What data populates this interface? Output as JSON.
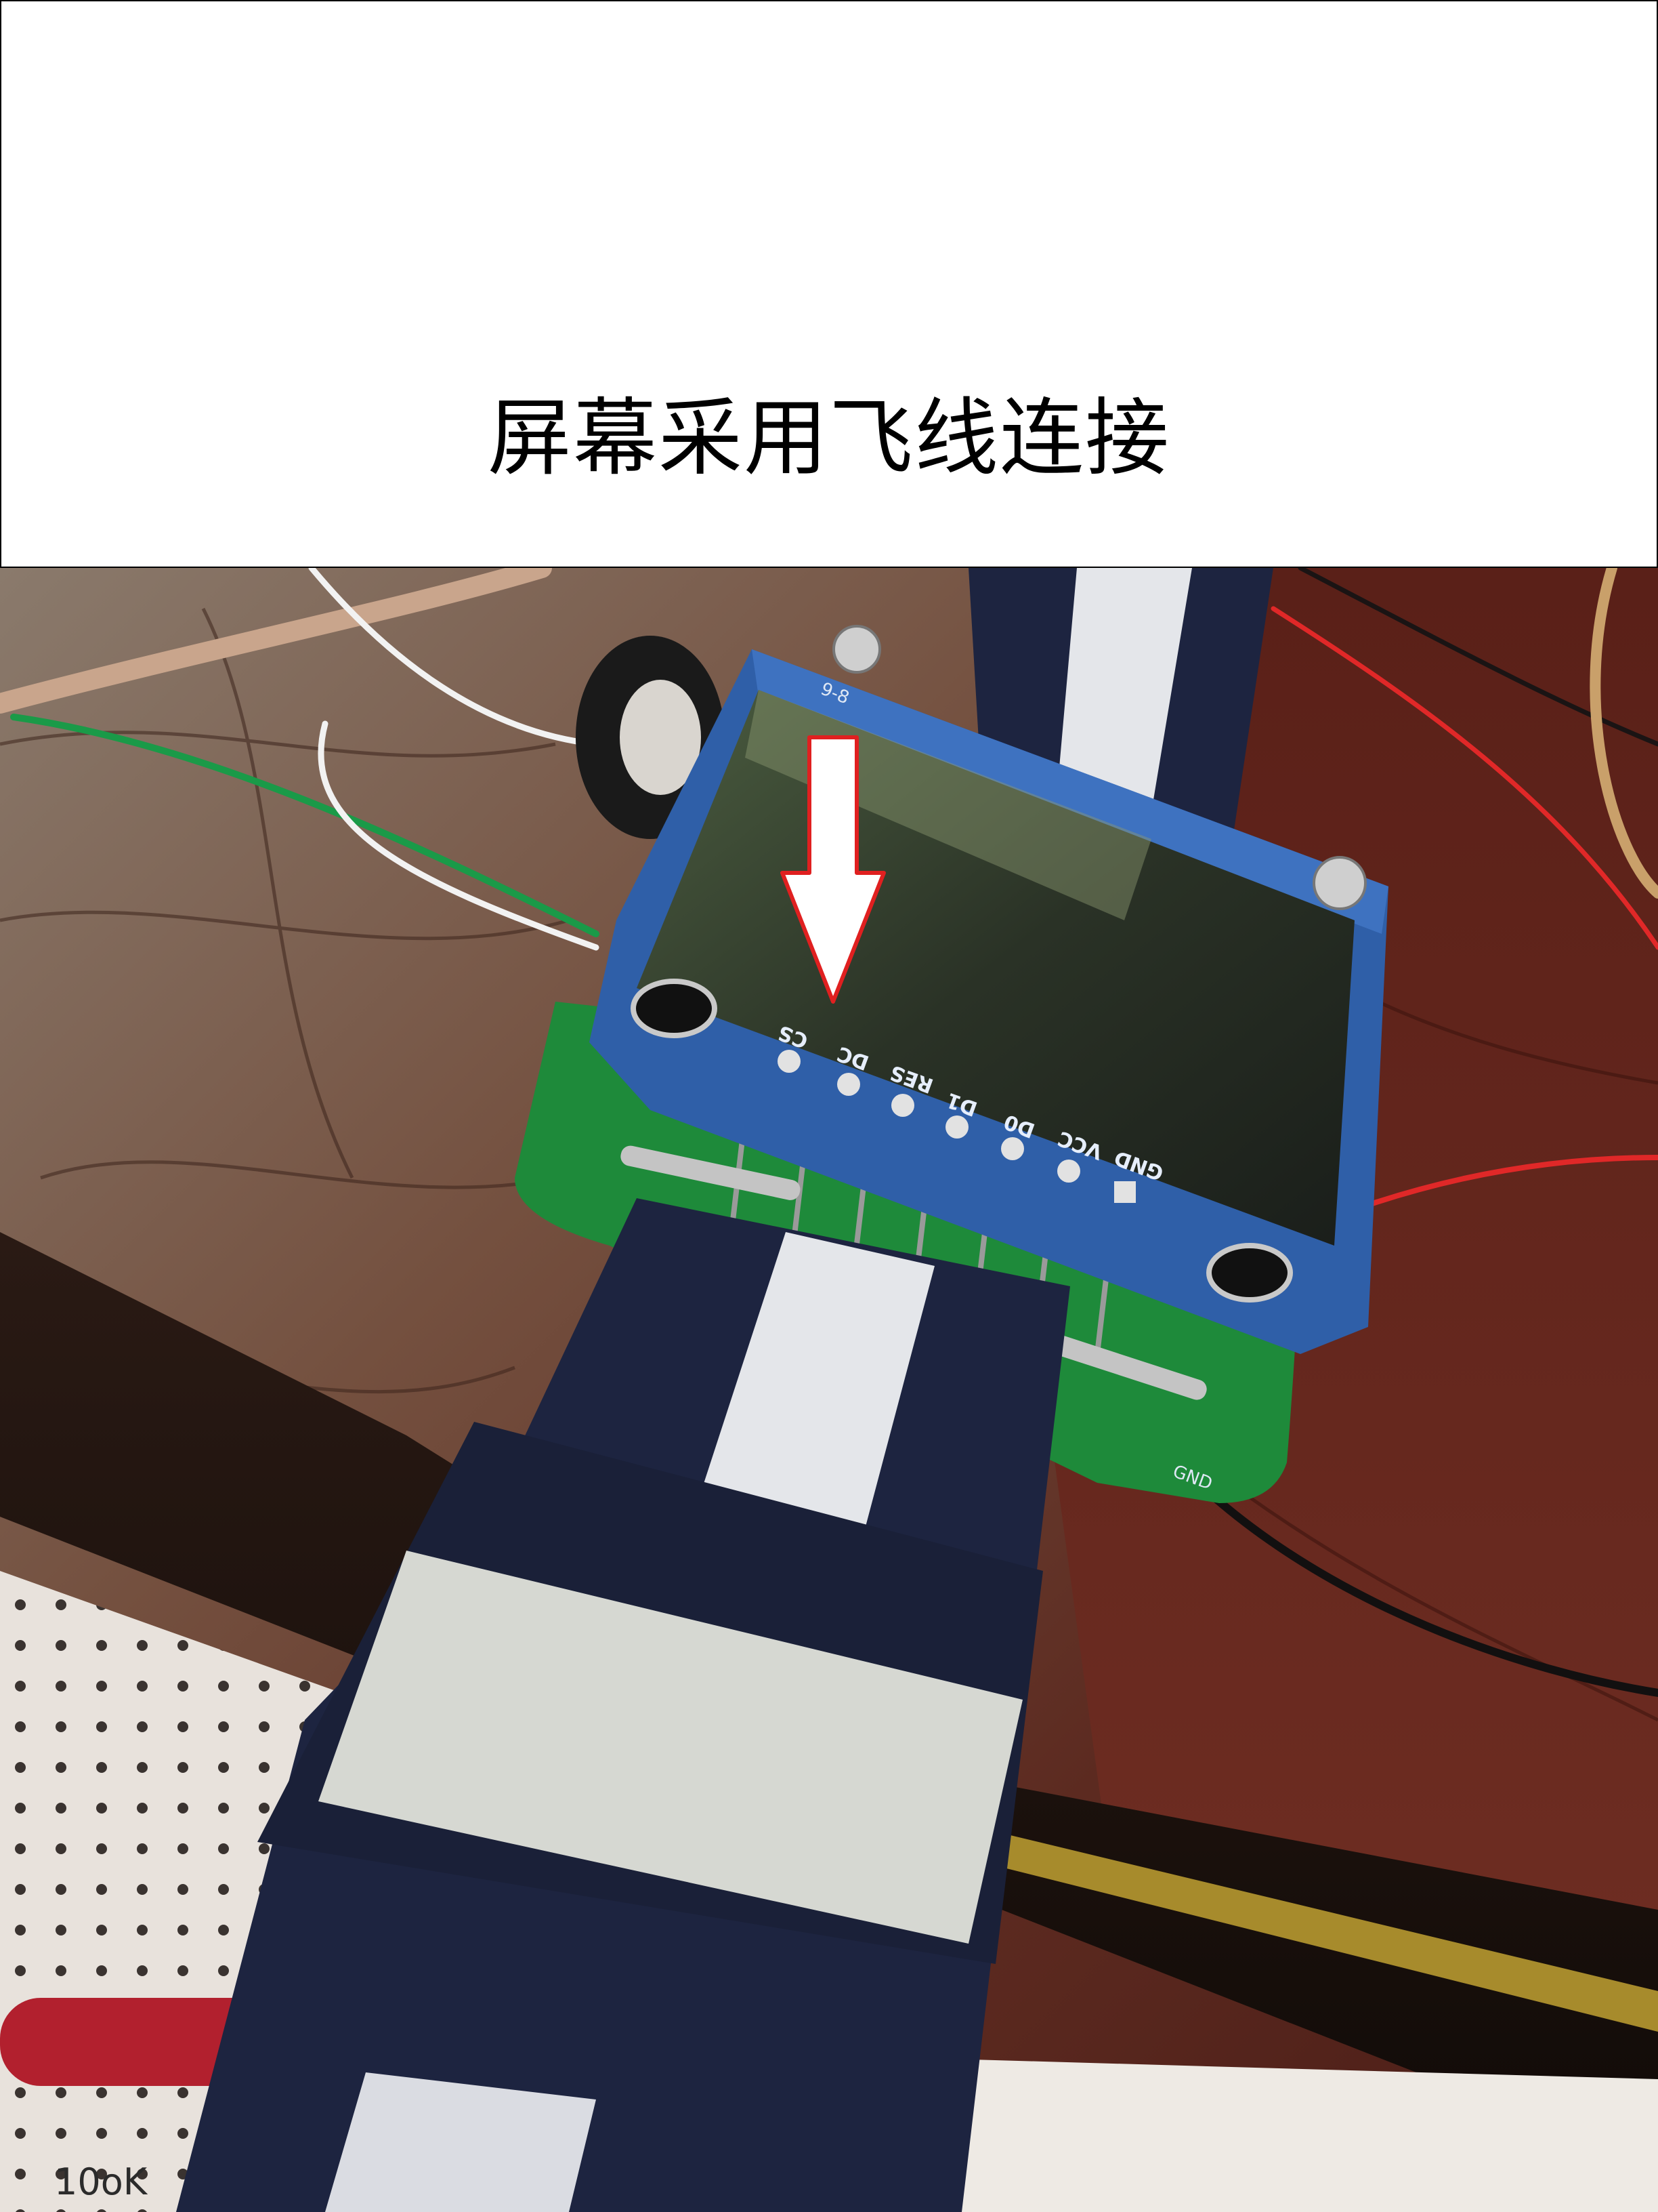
{
  "caption": {
    "text": "屏幕采用飞线连接"
  },
  "board": {
    "pin_labels": [
      "CS",
      "DC",
      "RES",
      "D1",
      "D0",
      "VCC",
      "GND"
    ],
    "top_marking": "9-8",
    "pcb_marking": "GND"
  },
  "annotation": {
    "arrow_color": "#e02020",
    "arrow_fill": "#ffffff"
  },
  "background_writing": {
    "text": "10oK"
  },
  "colors": {
    "wood": "#6a3226",
    "board_blue": "#2f5fa8",
    "pcb_green": "#1e8a3a",
    "strap_navy": "#1d2440",
    "strap_white": "#e4e6ea"
  }
}
